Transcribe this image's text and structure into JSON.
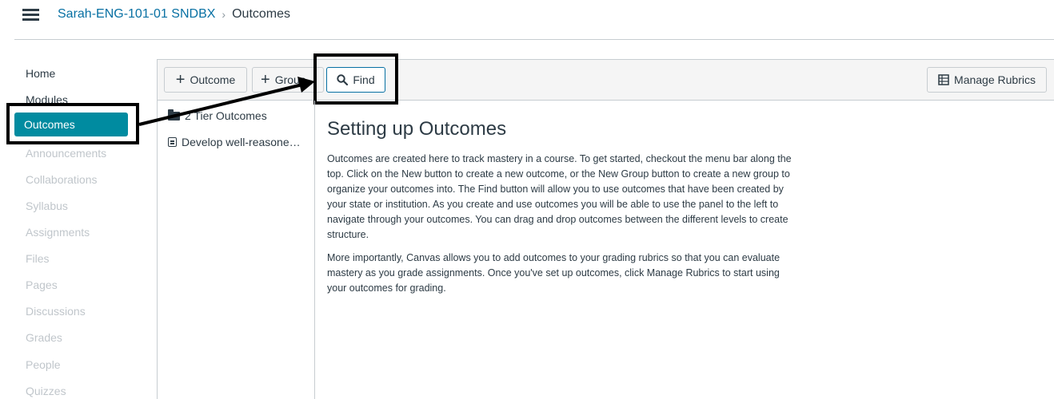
{
  "header": {
    "course": "Sarah-ENG-101-01 SNDBX",
    "separator": "›",
    "current": "Outcomes"
  },
  "nav": {
    "items": [
      {
        "label": "Home",
        "enabled": true
      },
      {
        "label": "Modules",
        "enabled": true
      },
      {
        "label": "Outcomes",
        "active": true
      },
      {
        "label": "Announcements",
        "enabled": false
      },
      {
        "label": "Collaborations",
        "enabled": false
      },
      {
        "label": "Syllabus",
        "enabled": false
      },
      {
        "label": "Assignments",
        "enabled": false
      },
      {
        "label": "Files",
        "enabled": false
      },
      {
        "label": "Pages",
        "enabled": false
      },
      {
        "label": "Discussions",
        "enabled": false
      },
      {
        "label": "Grades",
        "enabled": false
      },
      {
        "label": "People",
        "enabled": false
      },
      {
        "label": "Quizzes",
        "enabled": false
      }
    ]
  },
  "toolbar": {
    "outcome_label": "Outcome",
    "group_label": "Group",
    "find_label": "Find",
    "manage_rubrics_label": "Manage Rubrics"
  },
  "tree": {
    "items": [
      {
        "label": "2 Tier Outcomes",
        "icon": "folder-icon"
      },
      {
        "label": "Develop well-reasone…",
        "icon": "outcome-icon"
      }
    ]
  },
  "content": {
    "title": "Setting up Outcomes",
    "paragraph1": "Outcomes are created here to track mastery in a course. To get started, checkout the menu bar along the top. Click on the New button to create a new outcome, or the New Group button to create a new group to organize your outcomes into. The Find button will allow you to use outcomes that have been created by your state or institution. As you create and use outcomes you will be able to use the panel to the left to navigate through your outcomes. You can drag and drop outcomes between the different levels to create structure.",
    "paragraph2": "More importantly, Canvas allows you to add outcomes to your grading rubrics so that you can evaluate mastery as you grade assignments. Once you've set up outcomes, click Manage Rubrics to start using your outcomes for grading."
  },
  "colors": {
    "accent": "#008ba0",
    "link": "#0770a3",
    "text": "#2d3b45",
    "disabled": "#c0c6cb"
  }
}
